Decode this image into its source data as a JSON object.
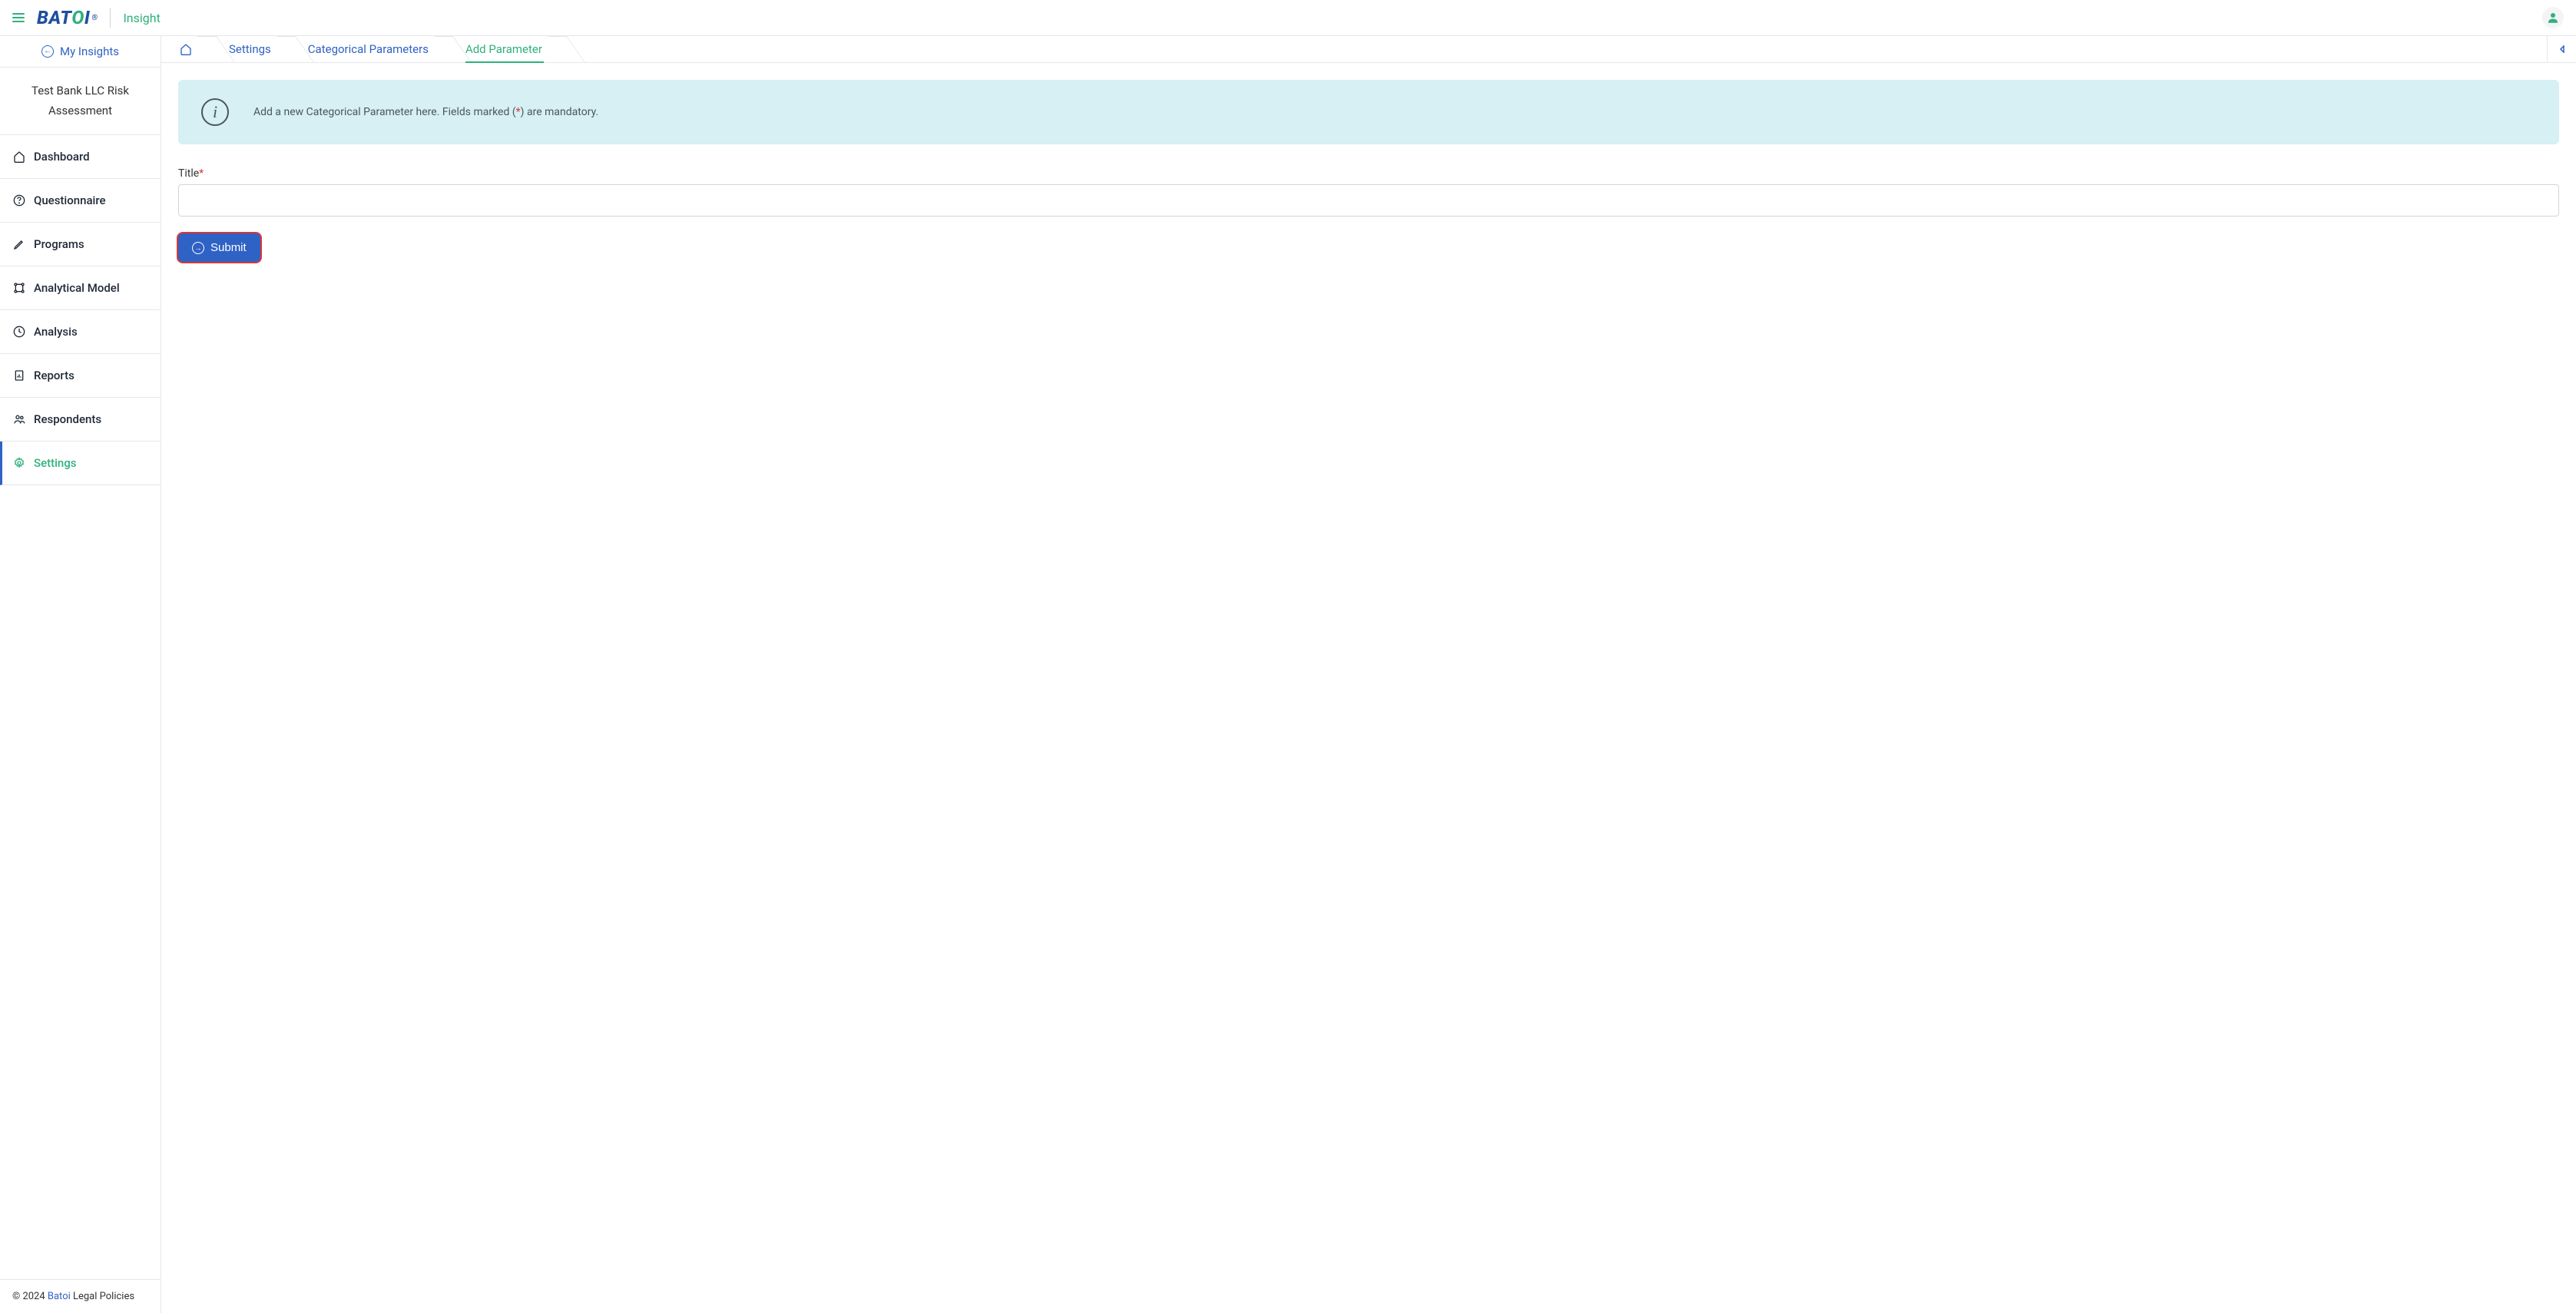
{
  "header": {
    "logo_text": "BATOI",
    "app_name": "Insight"
  },
  "sidebar": {
    "my_insights_label": "My Insights",
    "project_title": "Test Bank LLC Risk Assessment",
    "nav": [
      {
        "label": "Dashboard",
        "icon": "home-icon"
      },
      {
        "label": "Questionnaire",
        "icon": "question-circle-icon"
      },
      {
        "label": "Programs",
        "icon": "pen-icon"
      },
      {
        "label": "Analytical Model",
        "icon": "model-icon"
      },
      {
        "label": "Analysis",
        "icon": "clock-icon"
      },
      {
        "label": "Reports",
        "icon": "report-icon"
      },
      {
        "label": "Respondents",
        "icon": "users-icon"
      },
      {
        "label": "Settings",
        "icon": "gear-icon"
      }
    ]
  },
  "footer": {
    "copyright_prefix": "© 2024 ",
    "link_text": "Batoi",
    "copyright_suffix": " Legal Policies"
  },
  "breadcrumbs": {
    "items": [
      {
        "label": "Settings"
      },
      {
        "label": "Categorical Parameters"
      },
      {
        "label": "Add Parameter"
      }
    ]
  },
  "banner": {
    "text_before": "Add a new Categorical Parameter here. Fields marked (",
    "asterisk": "*",
    "text_after": ") are mandatory."
  },
  "form": {
    "title_label": "Title",
    "title_value": "",
    "submit_label": "Submit"
  }
}
